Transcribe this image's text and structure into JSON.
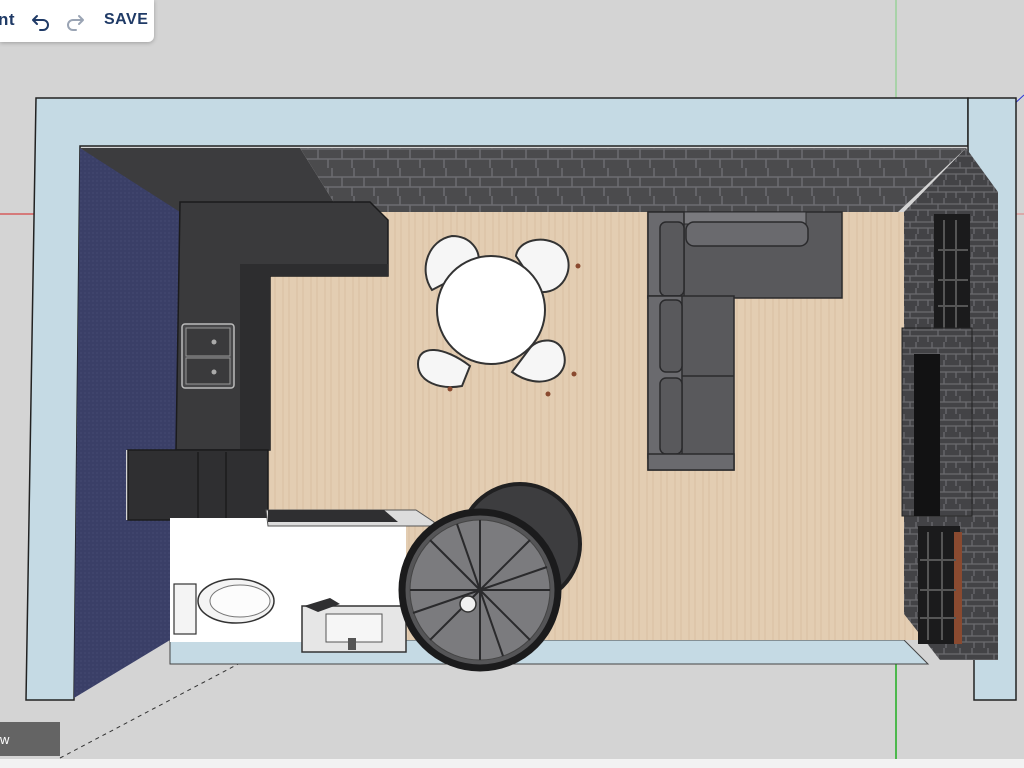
{
  "toolbar": {
    "partial_label": "nt",
    "save_label": "SAVE",
    "undo_icon": "undo-icon",
    "redo_icon": "redo-icon"
  },
  "bottom_tab": {
    "label": "w"
  },
  "scene": {
    "description_icons": [
      "kitchen-counter",
      "double-sink",
      "dining-table",
      "chairs",
      "sectional-sofa",
      "fireplace",
      "windows",
      "toilet",
      "bathroom-vanity",
      "spiral-staircase"
    ]
  },
  "colors": {
    "background": "#d4d4d4",
    "wall": "#c5dae4",
    "floor": "#e3cdb2",
    "accent_text": "#1f3a66",
    "axis_red": "#d62020",
    "axis_green": "#1fae1f",
    "axis_blue": "#2a32d8"
  }
}
